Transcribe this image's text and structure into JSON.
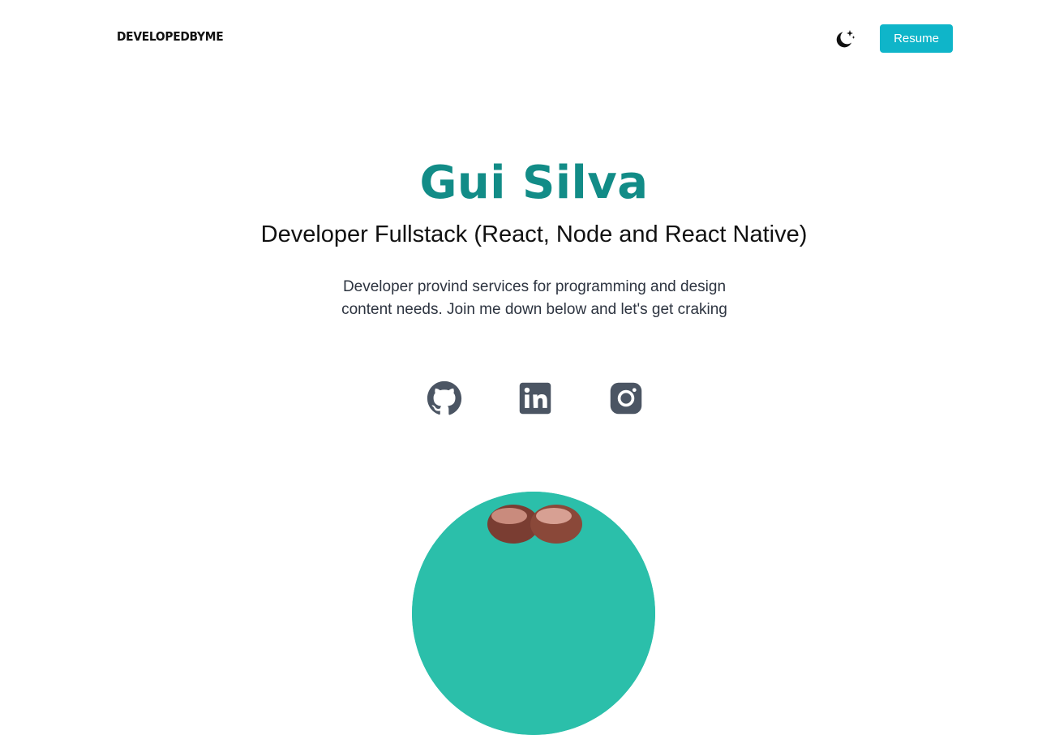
{
  "nav": {
    "logo": "DEVELOPEDBYME",
    "theme_toggle_icon": "moon-stars-icon",
    "resume_label": "Resume"
  },
  "hero": {
    "name": "Gui Silva",
    "role": "Developer Fullstack (React, Node and React Native)",
    "description": "Developer provind services for programming and design content needs. Join me down below and let's get craking"
  },
  "social": [
    {
      "name": "github",
      "icon": "github-icon"
    },
    {
      "name": "linkedin",
      "icon": "linkedin-icon"
    },
    {
      "name": "instagram",
      "icon": "instagram-icon"
    }
  ],
  "colors": {
    "accent": "#128c87",
    "button": "#0fb5c9",
    "icon": "#4b5563",
    "avatar_bg": "#2bbfaa"
  }
}
